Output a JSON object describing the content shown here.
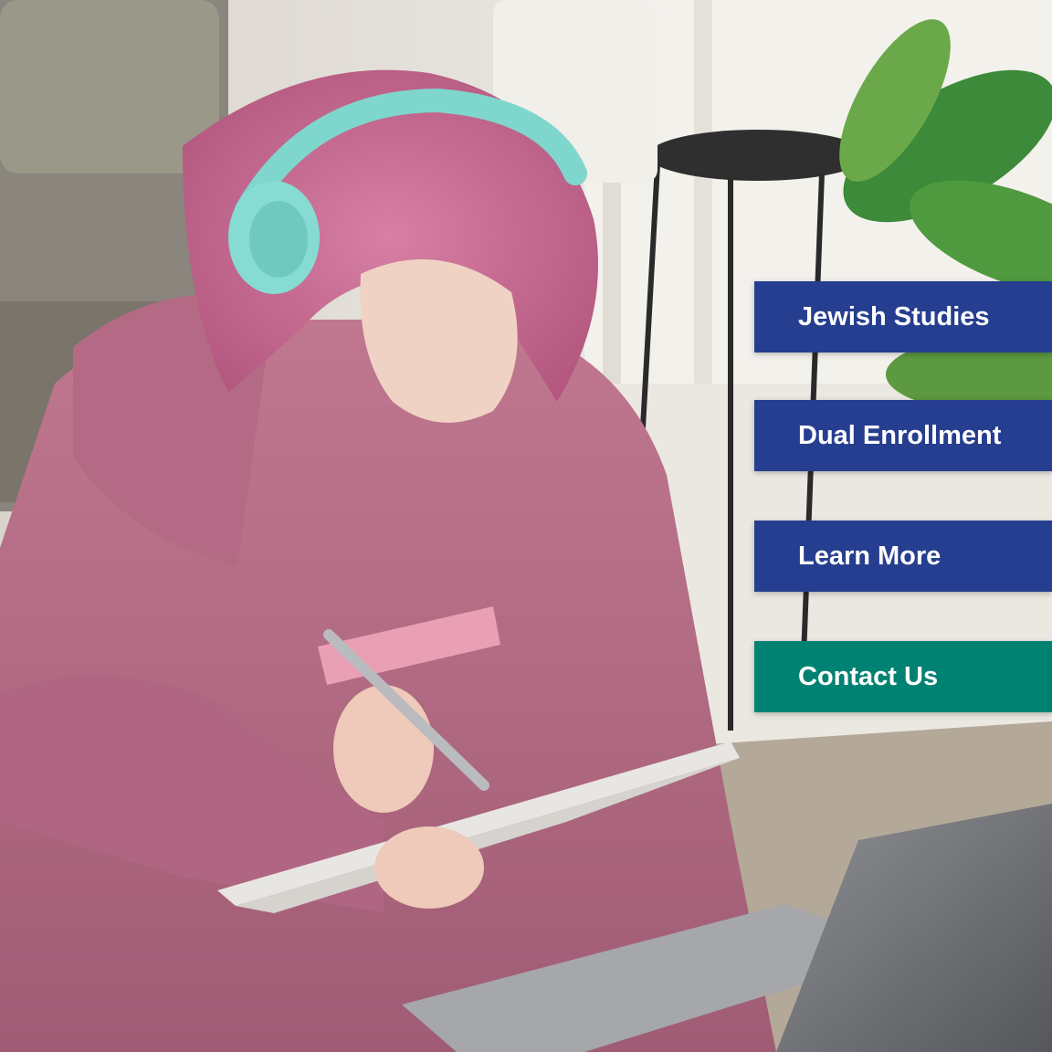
{
  "nav_buttons": {
    "jewish_studies": "Jewish Studies",
    "dual_enrollment": "Dual Enrollment",
    "learn_more": "Learn More",
    "contact_us": "Contact Us"
  },
  "colors": {
    "primary_blue": "#263e8f",
    "contact_green": "#008272"
  }
}
